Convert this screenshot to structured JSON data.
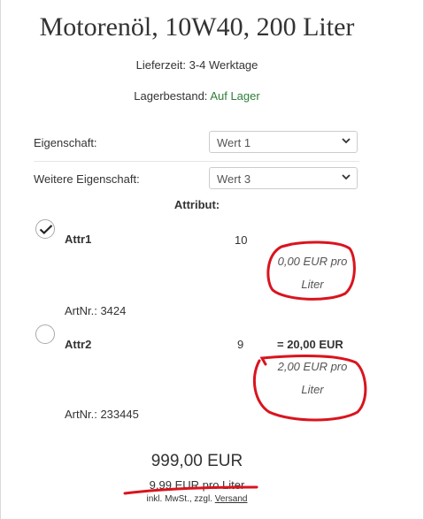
{
  "product": {
    "title": "Motorenöl, 10W40, 200 Liter",
    "delivery_label": "Lieferzeit:",
    "delivery_value": "3-4 Werktage",
    "stock_label": "Lagerbestand:",
    "stock_value": "Auf Lager"
  },
  "properties": [
    {
      "label": "Eigenschaft:",
      "selected": "Wert 1"
    },
    {
      "label": "Weitere Eigenschaft:",
      "selected": "Wert 3"
    }
  ],
  "attributes": {
    "heading": "Attribut:",
    "items": [
      {
        "name": "Attr1",
        "quantity": "10",
        "total": "",
        "per_unit_line1": "0,00 EUR pro",
        "per_unit_line2": "Liter",
        "artnr": "ArtNr.: 3424",
        "selected": true
      },
      {
        "name": "Attr2",
        "quantity": "9",
        "total": "= 20,00 EUR",
        "per_unit_line1": "2,00 EUR pro",
        "per_unit_line2": "Liter",
        "artnr": "ArtNr.: 233445",
        "selected": false
      }
    ]
  },
  "pricing": {
    "price": "999,00 EUR",
    "unit_price": "9,99 EUR pro Liter",
    "tax_note": "inkl. MwSt., zzgl.",
    "shipping_link": "Versand"
  },
  "colors": {
    "stock_green": "#2f7d3a",
    "annotation_red": "#d9141e"
  }
}
